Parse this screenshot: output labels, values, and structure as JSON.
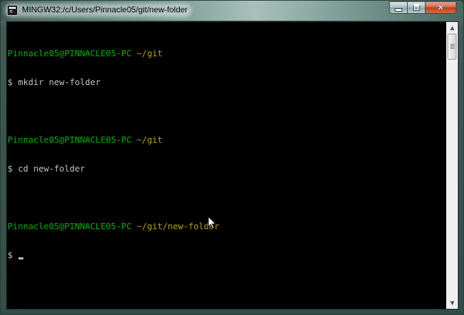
{
  "window": {
    "title": "MINGW32:/c/Users/Pinnacle05/git/new-folder",
    "icon": "terminal-app-icon",
    "controls": {
      "minimize": "minimize-icon",
      "maximize": "maximize-icon",
      "close": "close-icon"
    }
  },
  "terminal": {
    "lines": [
      {
        "user": "Pinnacle05@PINNACLE05-PC",
        "path": "~/git"
      },
      {
        "prompt": "$",
        "command": "mkdir new-folder"
      },
      {
        "user": "Pinnacle05@PINNACLE05-PC",
        "path": "~/git"
      },
      {
        "prompt": "$",
        "command": "cd new-folder"
      },
      {
        "user": "Pinnacle05@PINNACLE05-PC",
        "path": "~/git/new-folder"
      },
      {
        "prompt": "$",
        "command": ""
      }
    ]
  },
  "colors": {
    "background": "#000000",
    "text": "#c0c0c0",
    "user": "#00b000",
    "path": "#b4a000"
  }
}
